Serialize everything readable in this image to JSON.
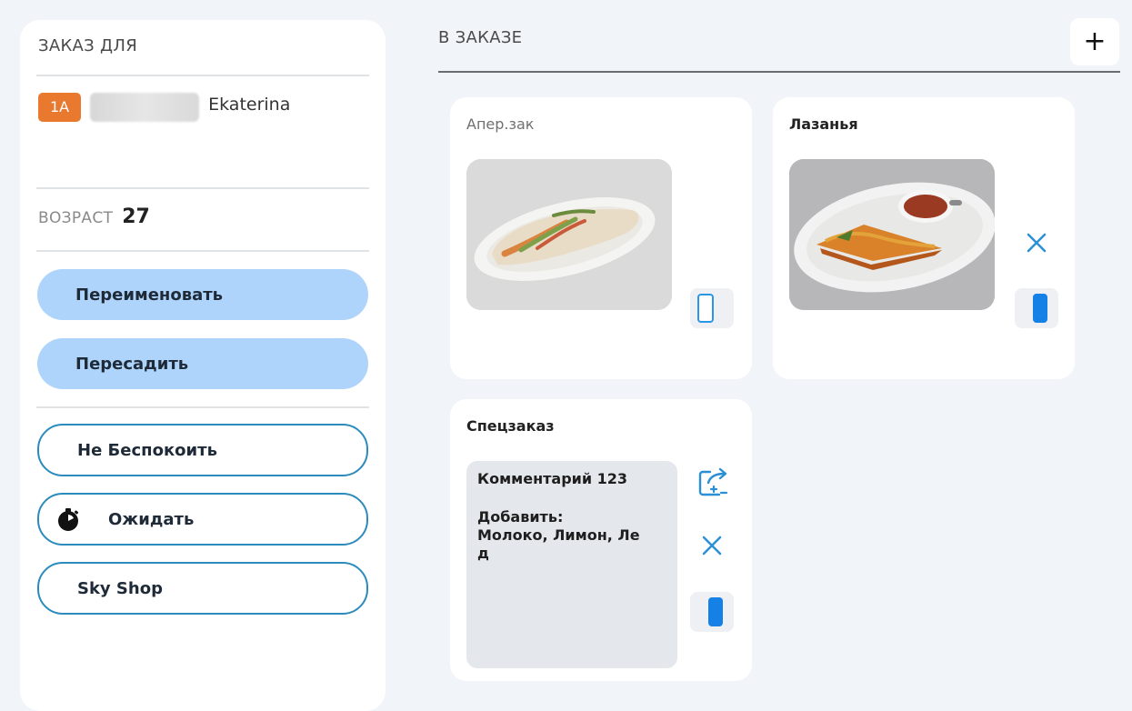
{
  "order_for": {
    "title": "ЗАКАЗ ДЛЯ",
    "seat": "1A",
    "passenger_name": "Ekaterina",
    "age_label": "ВОЗРАСТ",
    "age_value": "27"
  },
  "actions": {
    "rename": "Переименовать",
    "reseat": "Пересадить",
    "do_not_disturb": "Не Беспокоить",
    "wait": "Ожидать",
    "sky_shop": "Sky Shop"
  },
  "in_order": {
    "title": "В ЗАКАЗЕ",
    "add_label": "+",
    "items": [
      {
        "title": "Апер.зак",
        "image_icon": "wrap-dish-photo",
        "toggle_on": false
      },
      {
        "title": "Лазанья",
        "image_icon": "lasagna-dish-photo",
        "toggle_on": true,
        "has_remove": true
      },
      {
        "title": "Спецзаказ",
        "comment_line": "Комментарий 123",
        "add_label": "Добавить:",
        "add_items_line1": "Молоко, Лимон, Ле",
        "add_items_line2": "д",
        "toggle_on": true,
        "has_remove": true,
        "has_move": true
      }
    ]
  },
  "colors": {
    "accent_fill": "#aed4fb",
    "outline": "#2c8bbd",
    "seat_badge": "#e8792f",
    "toggle_on": "#1580e6",
    "remove_icon": "#2b8fd6"
  }
}
